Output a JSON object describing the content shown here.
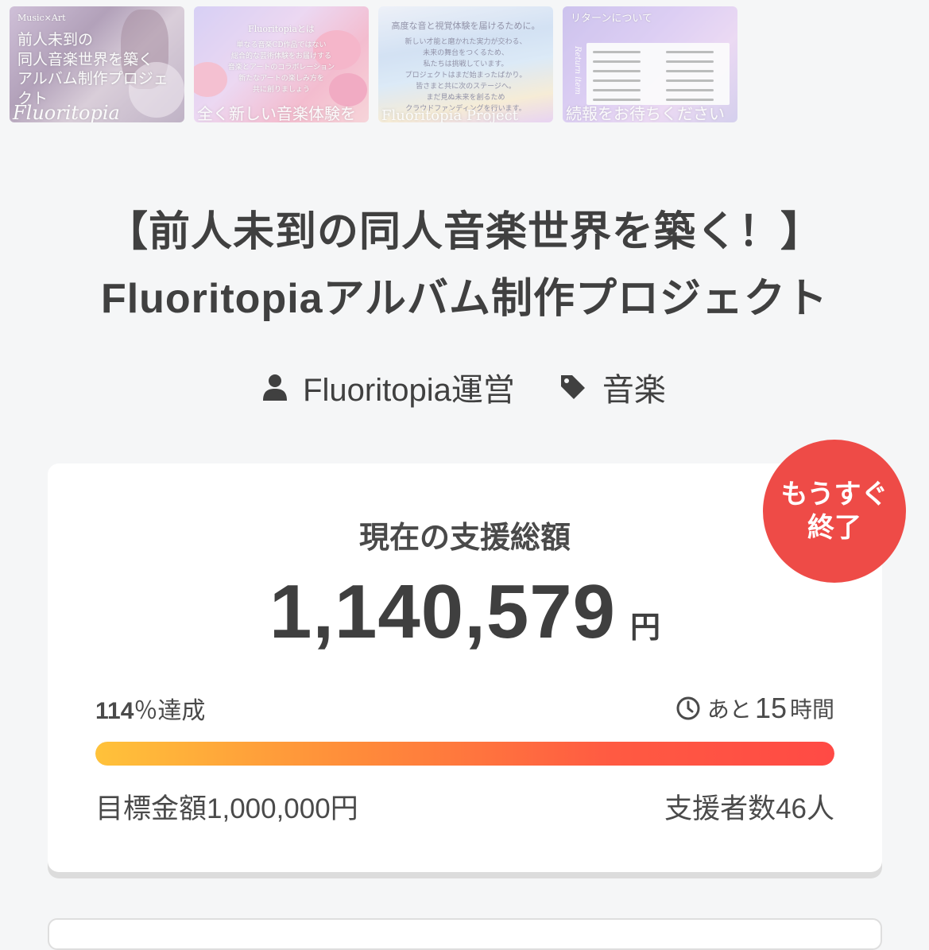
{
  "gallery": [
    {
      "top": "Music×Art",
      "big": "前人未到の\n同人音楽世界を築く\nアルバム制作プロジェクト",
      "bottom": "Fluoritopia"
    },
    {
      "head": "Fluoritopiaとは",
      "body": "単なる音楽CD作品ではない\n総合的な芸術体験をお届けする\n音楽とアートのコラボレーション\n新たなアートの楽しみ方を\n共に創りましょう",
      "bottom": "全く新しい音楽体験を"
    },
    {
      "head": "高度な音と視覚体験を届けるために。",
      "body": "新しい才能と磨かれた実力が交わる、\n未来の舞台をつくるため、\n私たちは挑戦しています。\nプロジェクトはまだ始まったばかり。\n皆さまと共に次のステージへ。\nまだ見ぬ未来を創るため\nクラウドファンディングを行います。",
      "bottom": "Fluoritopia Project"
    },
    {
      "head": "リターンについて",
      "side": "Return item",
      "bottom": "続報をお待ちください"
    }
  ],
  "title_line1": "【前人未到の同人音楽世界を築く！】",
  "title_line2": "Fluoritopiaアルバム制作プロジェクト",
  "owner": "Fluoritopia運営",
  "category": "音楽",
  "badge_line1": "もうすぐ",
  "badge_line2": "終了",
  "support_label": "現在の支援総額",
  "amount": "1,140,579",
  "yen": "円",
  "percent": "114",
  "percent_label": "％達成",
  "remaining_prefix": "あと",
  "remaining_value": "15",
  "remaining_unit": "時間",
  "progress_fraction": 1.0,
  "goal_text": "目標金額1,000,000円",
  "backers_text": "支援者数46人",
  "colors": {
    "badge": "#ee4b47",
    "progress_start": "#ffc23a",
    "progress_end": "#ff4a45"
  }
}
